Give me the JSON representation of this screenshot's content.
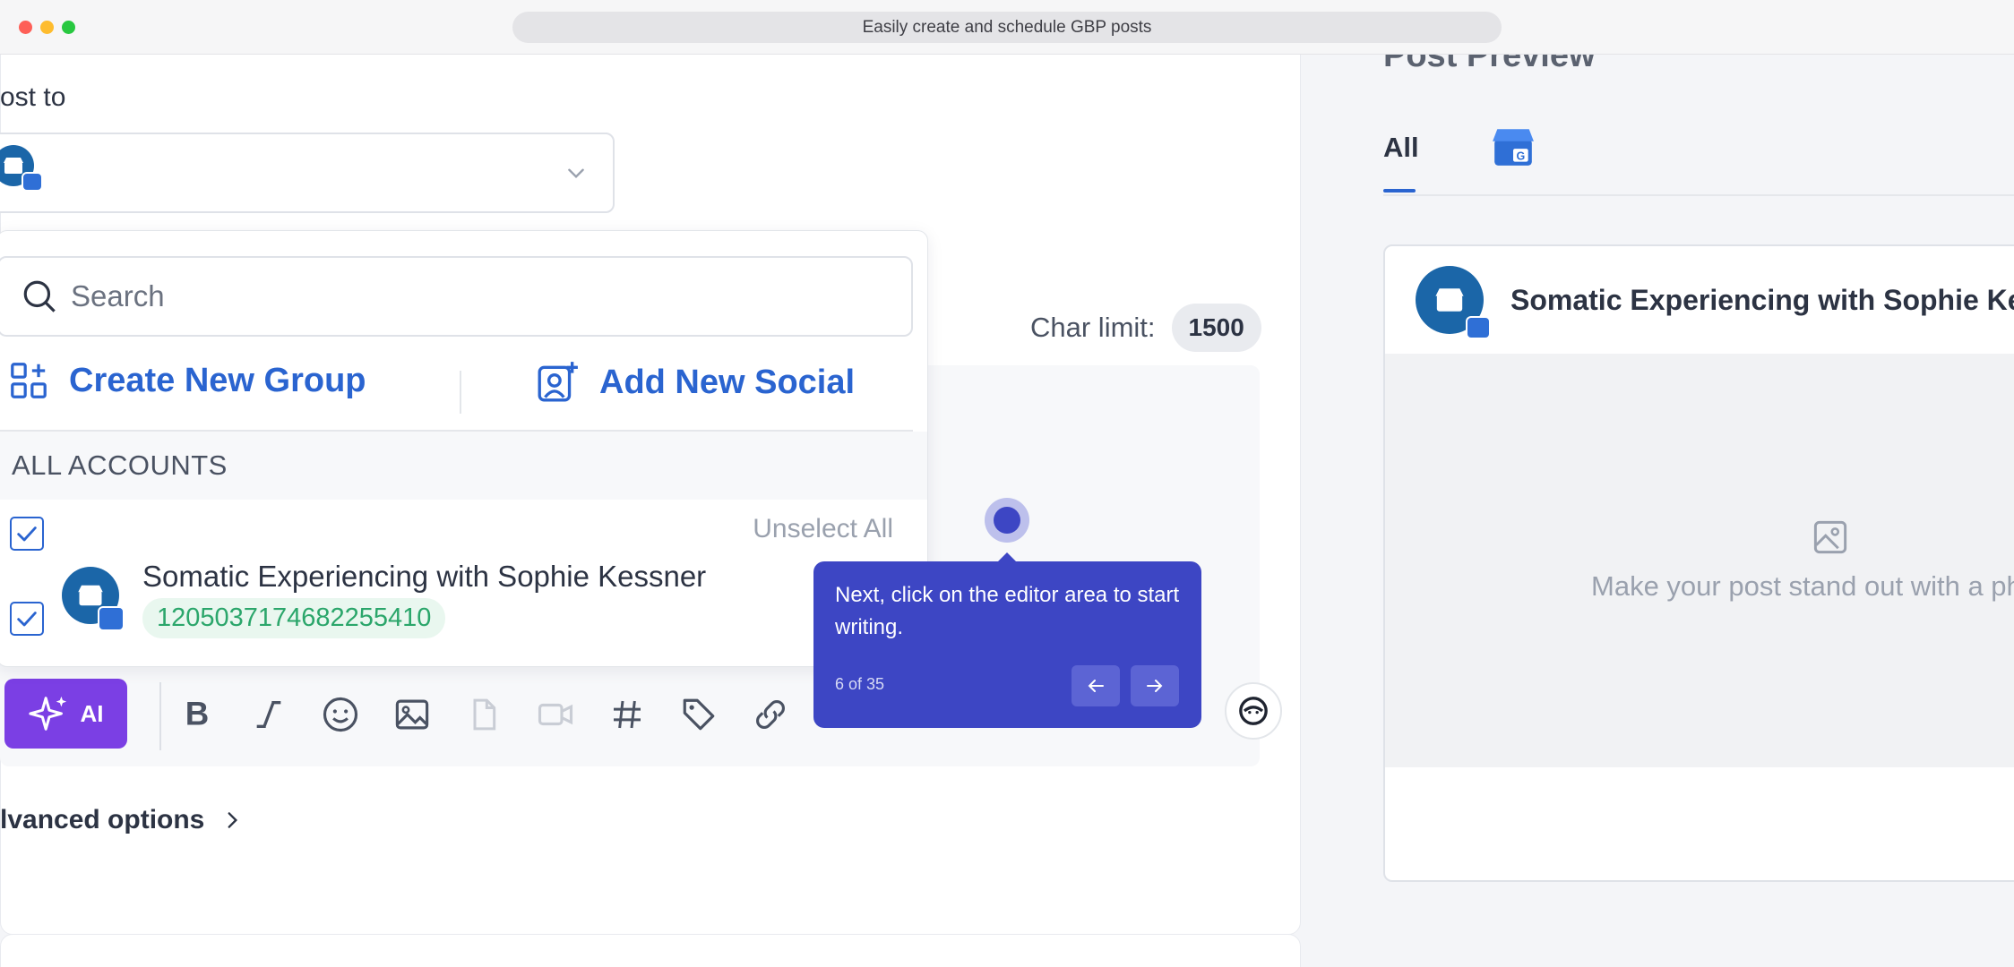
{
  "window": {
    "url_title": "Easily create and schedule GBP posts"
  },
  "composer": {
    "post_to_label": "ost to",
    "char_limit_label": "Char limit:",
    "char_limit_value": "1500",
    "advanced_options_label": "lvanced options",
    "ai_button_label": "AI"
  },
  "dropdown": {
    "search_placeholder": "Search",
    "create_group_label": "Create New Group",
    "add_social_label": "Add New Social",
    "section_label": "ALL ACCOUNTS",
    "unselect_all_label": "Unselect All",
    "account": {
      "name": "Somatic Experiencing with Sophie Kessner",
      "id": "1205037174682255410",
      "checked": true
    }
  },
  "tour": {
    "text": "Next, click on the editor area to start writing.",
    "step": "6 of 35"
  },
  "preview": {
    "title": "Post Preview",
    "tab_all": "All",
    "account_name": "Somatic Experiencing with Sophie Kessn",
    "media_hint": "Make your post stand out with a ph"
  },
  "colors": {
    "accent_blue": "#2a64d0",
    "tour_purple": "#3d46c4",
    "ai_purple": "#7b3fe4",
    "success_green": "#2ba66b"
  }
}
